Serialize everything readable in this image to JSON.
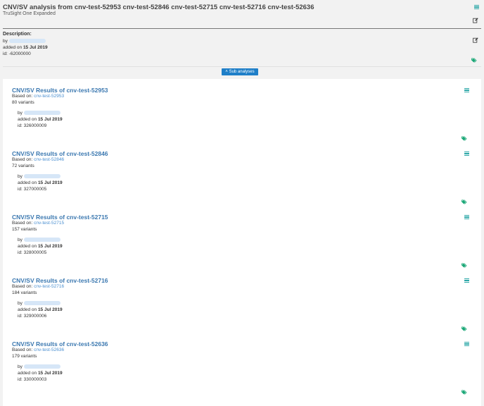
{
  "header": {
    "title": "CNV/SV analysis from cnv-test-52953 cnv-test-52846 cnv-test-52715 cnv-test-52716 cnv-test-52636",
    "subtitle": "TruSight One Expanded"
  },
  "description": {
    "label": "Description:",
    "by_label": "by",
    "added_label": "added on",
    "added_date": "15 Jul 2019",
    "id_text": "id: -62000000"
  },
  "sub_analyses_button": "Sub analyses",
  "cards": [
    {
      "title": "CNV/SV Results of cnv-test-52953",
      "based_label": "Based on:",
      "based_link": "cnv-test-52953",
      "variants": "80 variants",
      "by_label": "by",
      "added_label": "added on",
      "added_date": "15 Jul 2019",
      "id_text": "id: 326000009"
    },
    {
      "title": "CNV/SV Results of cnv-test-52846",
      "based_label": "Based on:",
      "based_link": "cnv-test-52846",
      "variants": "72 variants",
      "by_label": "by",
      "added_label": "added on",
      "added_date": "15 Jul 2019",
      "id_text": "id: 327000005"
    },
    {
      "title": "CNV/SV Results of cnv-test-52715",
      "based_label": "Based on:",
      "based_link": "cnv-test-52715",
      "variants": "157 variants",
      "by_label": "by",
      "added_label": "added on",
      "added_date": "15 Jul 2019",
      "id_text": "id: 328000005"
    },
    {
      "title": "CNV/SV Results of cnv-test-52716",
      "based_label": "Based on:",
      "based_link": "cnv-test-52716",
      "variants": "184 variants",
      "by_label": "by",
      "added_label": "added on",
      "added_date": "15 Jul 2019",
      "id_text": "id: 329000006"
    },
    {
      "title": "CNV/SV Results of cnv-test-52636",
      "based_label": "Based on:",
      "based_link": "cnv-test-52636",
      "variants": "179 variants",
      "by_label": "by",
      "added_label": "added on",
      "added_date": "15 Jul 2019",
      "id_text": "id: 330000003"
    }
  ],
  "icons": {
    "menu": "hamburger-menu-icon",
    "edit": "edit-icon",
    "tags": "tags-icon",
    "chevron": "chevron-up-icon"
  },
  "colors": {
    "accent_teal": "#2aa7a7",
    "link_blue": "#3b78b0",
    "button_blue": "#1f7fc8",
    "tag_green": "#1aa776"
  }
}
